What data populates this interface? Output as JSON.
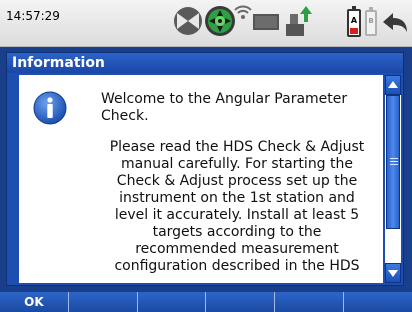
{
  "status_bar": {
    "time": "14:57:29",
    "icons": [
      "communication-off-icon",
      "target-lock-icon",
      "signal-icon",
      "card-icon",
      "usb-transfer-icon",
      "battery-a-icon",
      "battery-b-icon",
      "back-icon"
    ],
    "battery_a_label": "A",
    "battery_b_label": "B",
    "battery_a_level": 0.25
  },
  "dialog": {
    "title": "Information",
    "icon": "info-icon",
    "paragraph1": "Welcome to the Angular Parameter Check.",
    "paragraph2": "Please read the HDS Check & Adjust manual carefully. For starting the Check & Adjust process set up the instrument on the 1st station and level it accurately. Install at least 5 targets according to the recommended measurement configuration described  in the HDS"
  },
  "softkeys": [
    "OK",
    "",
    "",
    "",
    "",
    ""
  ],
  "colors": {
    "title_bar": "#1d4fb0",
    "body": "#ffffff",
    "softkey_bar": "#2a5fbf"
  }
}
